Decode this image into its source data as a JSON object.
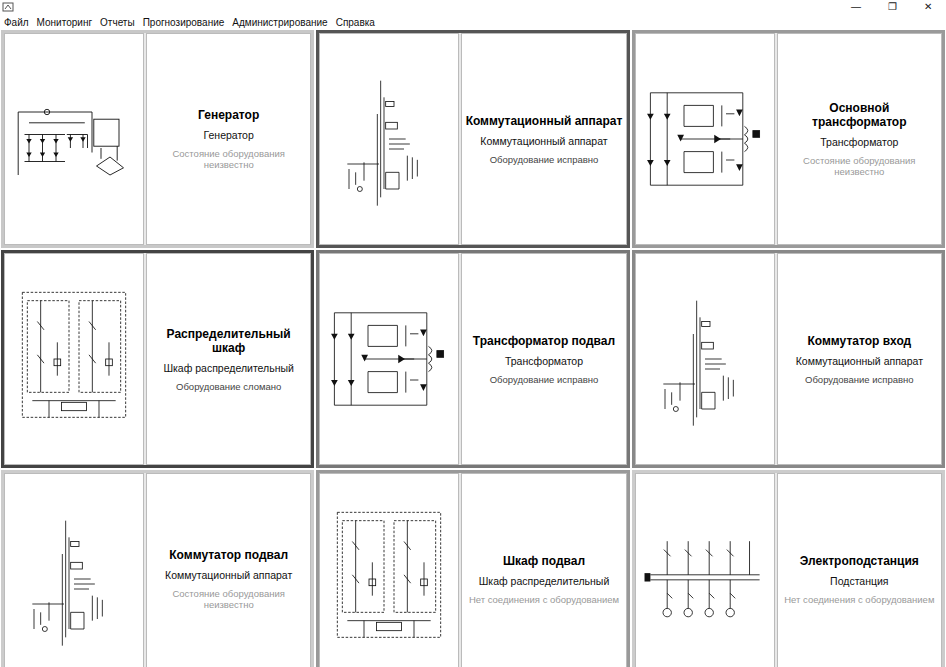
{
  "window": {
    "controls": [
      {
        "glyph": "—"
      },
      {
        "glyph": "❐"
      },
      {
        "glyph": "✕"
      }
    ]
  },
  "menu": [
    {
      "label": "Файл"
    },
    {
      "label": "Мониторинг"
    },
    {
      "label": "Отчеты"
    },
    {
      "label": "Прогнозирование"
    },
    {
      "label": "Администрирование"
    },
    {
      "label": "Справка"
    }
  ],
  "cards": [
    {
      "name": "Генератор",
      "type": "Генератор",
      "status": "Состояние оборудования неизвестно",
      "muted": true,
      "color": "#c8c8c8",
      "kind": "generator"
    },
    {
      "name": "Коммутационный аппарат",
      "type": "Коммутационный аппарат",
      "status": "Оборудование исправно",
      "muted": false,
      "color": "#555555",
      "kind": "switch"
    },
    {
      "name": "Основной трансформатор",
      "type": "Трансформатор",
      "status": "Состояние оборудования неизвестно",
      "muted": true,
      "color": "#9a9a9a",
      "kind": "transformer"
    },
    {
      "name": "Распределительный шкаф",
      "type": "Шкаф распределительный",
      "status": "Оборудование сломано",
      "muted": false,
      "color": "#444444",
      "kind": "cabinet"
    },
    {
      "name": "Трансформатор подвал",
      "type": "Трансформатор",
      "status": "Оборудование исправно",
      "muted": false,
      "color": "#777777",
      "kind": "transformer"
    },
    {
      "name": "Коммутатор вход",
      "type": "Коммутационный аппарат",
      "status": "Оборудование исправно",
      "muted": false,
      "color": "#888888",
      "kind": "switch"
    },
    {
      "name": "Коммутатор подвал",
      "type": "Коммутационный аппарат",
      "status": "Состояние оборудования неизвестно",
      "muted": true,
      "color": "#cccccc",
      "kind": "switch"
    },
    {
      "name": "Шкаф подвал",
      "type": "Шкаф распределительный",
      "status": "Нет соединения с оборудованием",
      "muted": true,
      "color": "#999999",
      "kind": "cabinet"
    },
    {
      "name": "Электроподстанция",
      "type": "Подстанция",
      "status": "Нет соединения с оборудованием",
      "muted": true,
      "color": "#cccccc",
      "kind": "substation"
    }
  ]
}
